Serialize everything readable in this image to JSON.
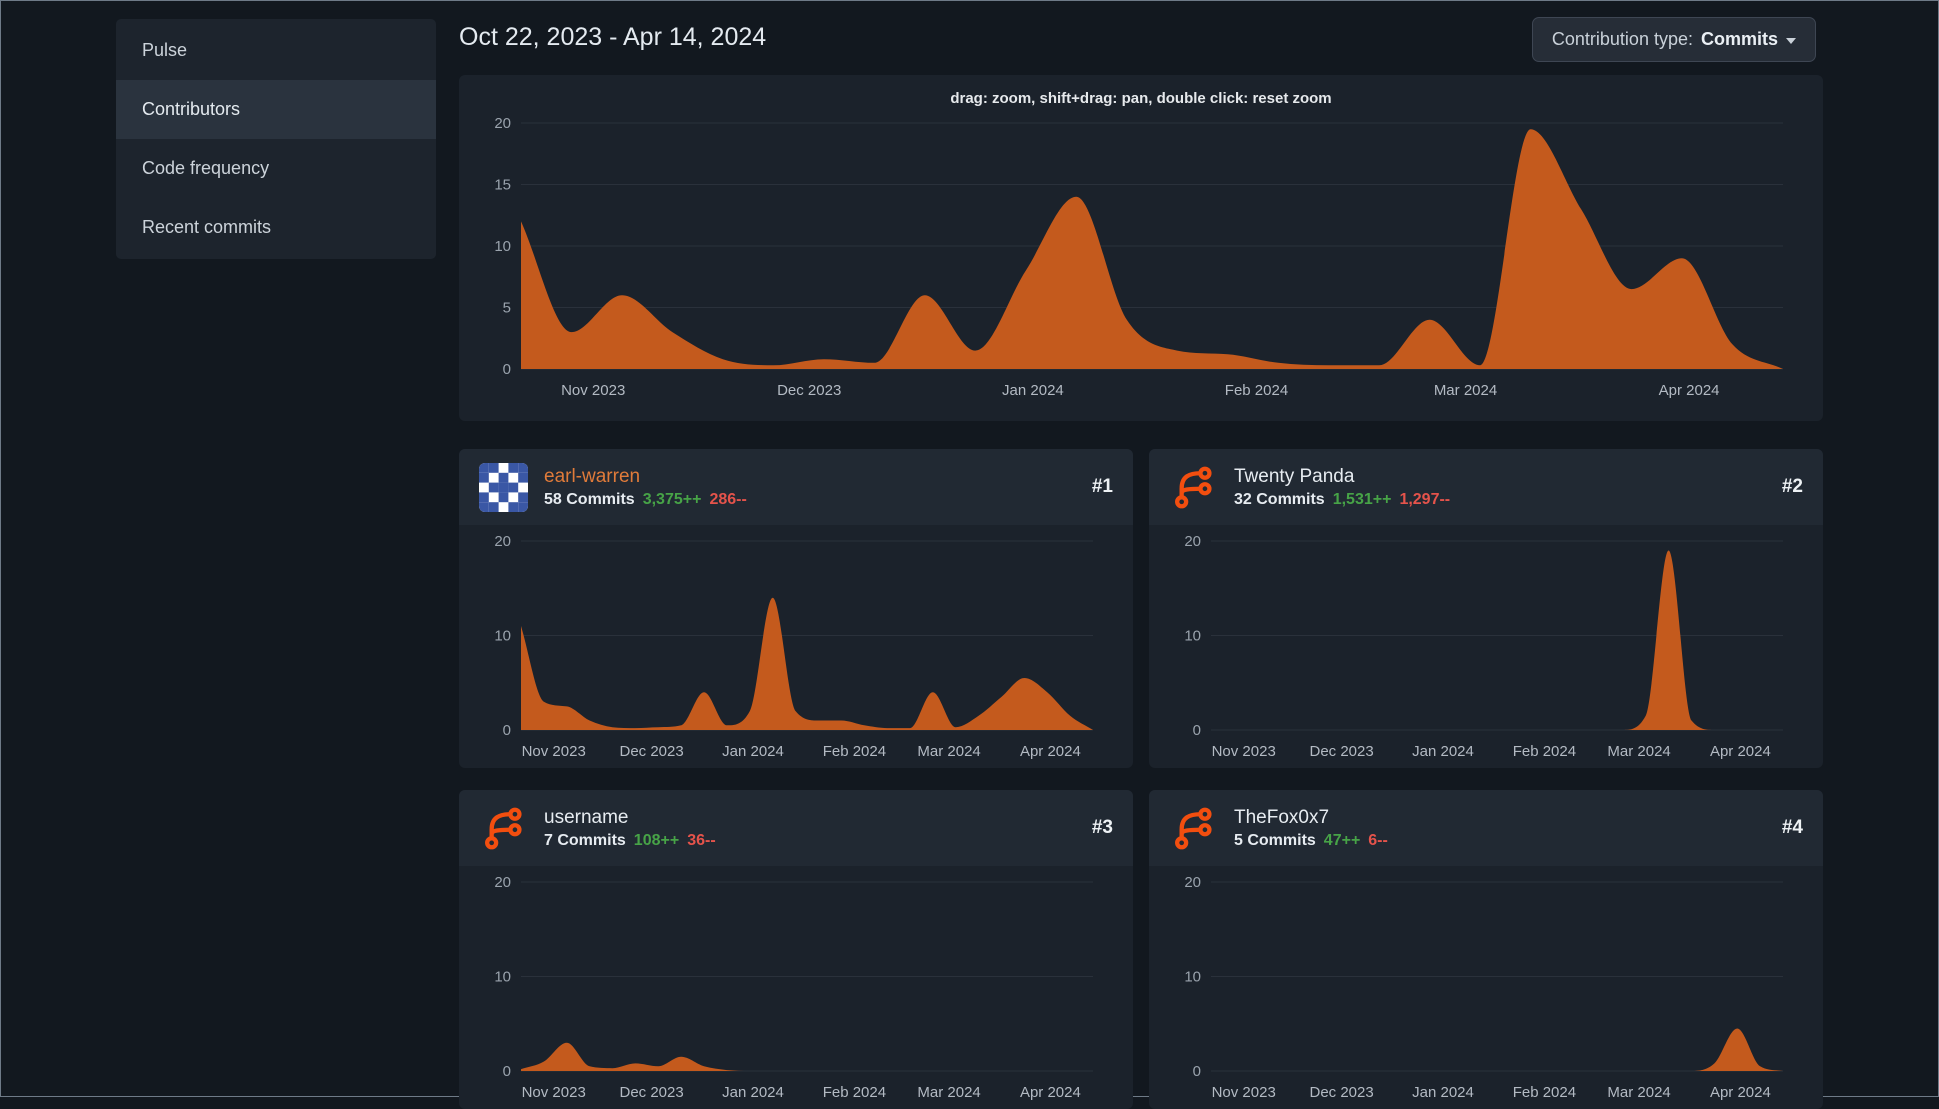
{
  "colors": {
    "page_bg": "#12181f",
    "panel_bg": "#1b222b",
    "chart_fill": "#c45a1d",
    "grid_line": "#2a313b",
    "axis_label": "#9aa3ad",
    "tick_label": "#b3bac3",
    "green": "#47a347",
    "red": "#e5534b",
    "link_orange": "#e07b3a",
    "logo_orange": "#f24e0f",
    "identicon_blue": "#3a57a5"
  },
  "sidebar": {
    "items": [
      {
        "label": "Pulse",
        "active": false
      },
      {
        "label": "Contributors",
        "active": true
      },
      {
        "label": "Code frequency",
        "active": false
      },
      {
        "label": "Recent commits",
        "active": false
      }
    ]
  },
  "header": {
    "date_range": "Oct 22, 2023 - Apr 14, 2024"
  },
  "contribution_type": {
    "label": "Contribution type:",
    "value": "Commits"
  },
  "main_chart_hint": "drag: zoom, shift+drag: pan, double click: reset zoom",
  "contributors": [
    {
      "name": "earl-warren",
      "rank": "#1",
      "commits_label": "58 Commits",
      "additions": "3,375++",
      "deletions": "286--",
      "avatar": "identicon"
    },
    {
      "name": "Twenty Panda",
      "rank": "#2",
      "commits_label": "32 Commits",
      "additions": "1,531++",
      "deletions": "1,297--",
      "avatar": "forgejo-logo"
    },
    {
      "name": "username",
      "rank": "#3",
      "commits_label": "7 Commits",
      "additions": "108++",
      "deletions": "36--",
      "avatar": "forgejo-logo"
    },
    {
      "name": "TheFox0x7",
      "rank": "#4",
      "commits_label": "5 Commits",
      "additions": "47++",
      "deletions": "6--",
      "avatar": "forgejo-logo"
    }
  ],
  "identicon_pattern": [
    [
      1,
      1,
      0,
      1,
      1
    ],
    [
      1,
      0,
      1,
      0,
      1
    ],
    [
      0,
      1,
      1,
      1,
      0
    ],
    [
      1,
      0,
      1,
      0,
      1
    ],
    [
      1,
      1,
      0,
      1,
      1
    ]
  ],
  "chart_data": [
    {
      "id": "overall-commits",
      "type": "area",
      "title": "",
      "xlabel": "",
      "ylabel": "",
      "ylim": [
        0,
        20
      ],
      "yticks": [
        0,
        5,
        10,
        15,
        20
      ],
      "grid": true,
      "legend": "none",
      "x_unit": "week (Oct 22, 2023 - Apr 14, 2024)",
      "x_weeks": 25,
      "xticks": [
        {
          "label": "Nov 2023",
          "week": 1.43
        },
        {
          "label": "Dec 2023",
          "week": 5.71
        },
        {
          "label": "Jan 2024",
          "week": 10.14
        },
        {
          "label": "Feb 2024",
          "week": 14.57
        },
        {
          "label": "Mar 2024",
          "week": 18.71
        },
        {
          "label": "Apr 2024",
          "week": 23.14
        }
      ],
      "values": [
        12,
        3,
        6,
        3,
        0.8,
        0.3,
        0.8,
        0.5,
        6,
        1.5,
        8,
        14,
        4,
        1.5,
        1.2,
        0.5,
        0.3,
        0.3,
        4,
        0.3,
        19.5,
        13,
        6.5,
        9,
        2,
        0
      ]
    },
    {
      "id": "earl-warren-commits",
      "type": "area",
      "ylim": [
        0,
        20
      ],
      "yticks": [
        0,
        10,
        20
      ],
      "grid": true,
      "x_weeks": 25,
      "xticks": [
        {
          "label": "Nov 2023",
          "week": 1.43
        },
        {
          "label": "Dec 2023",
          "week": 5.71
        },
        {
          "label": "Jan 2024",
          "week": 10.14
        },
        {
          "label": "Feb 2024",
          "week": 14.57
        },
        {
          "label": "Mar 2024",
          "week": 18.71
        },
        {
          "label": "Apr 2024",
          "week": 23.14
        }
      ],
      "values": [
        11,
        3,
        2.5,
        1,
        0.3,
        0.2,
        0.3,
        0.5,
        4,
        0.5,
        2,
        14,
        2,
        1,
        1,
        0.5,
        0.2,
        0.2,
        4,
        0.3,
        1.5,
        3.5,
        5.5,
        4,
        1.5,
        0
      ]
    },
    {
      "id": "twenty-panda-commits",
      "type": "area",
      "ylim": [
        0,
        20
      ],
      "yticks": [
        0,
        10,
        20
      ],
      "grid": true,
      "x_weeks": 25,
      "xticks": [
        {
          "label": "Nov 2023",
          "week": 1.43
        },
        {
          "label": "Dec 2023",
          "week": 5.71
        },
        {
          "label": "Jan 2024",
          "week": 10.14
        },
        {
          "label": "Feb 2024",
          "week": 14.57
        },
        {
          "label": "Mar 2024",
          "week": 18.71
        },
        {
          "label": "Apr 2024",
          "week": 23.14
        }
      ],
      "values": [
        0,
        0,
        0,
        0,
        0,
        0,
        0,
        0,
        0,
        0,
        0,
        0,
        0,
        0,
        0,
        0,
        0,
        0,
        0,
        1.5,
        19,
        1,
        0,
        0,
        0,
        0
      ]
    },
    {
      "id": "username-commits",
      "type": "area",
      "ylim": [
        0,
        20
      ],
      "yticks": [
        0,
        10,
        20
      ],
      "grid": true,
      "x_weeks": 25,
      "xticks": [
        {
          "label": "Nov 2023",
          "week": 1.43
        },
        {
          "label": "Dec 2023",
          "week": 5.71
        },
        {
          "label": "Jan 2024",
          "week": 10.14
        },
        {
          "label": "Feb 2024",
          "week": 14.57
        },
        {
          "label": "Mar 2024",
          "week": 18.71
        },
        {
          "label": "Apr 2024",
          "week": 23.14
        }
      ],
      "values": [
        0.2,
        1,
        3,
        0.5,
        0.3,
        0.8,
        0.5,
        1.5,
        0.5,
        0.1,
        0,
        0,
        0,
        0,
        0,
        0,
        0,
        0,
        0,
        0,
        0,
        0,
        0,
        0,
        0,
        0
      ]
    },
    {
      "id": "thefox0x7-commits",
      "type": "area",
      "ylim": [
        0,
        20
      ],
      "yticks": [
        0,
        10,
        20
      ],
      "grid": true,
      "x_weeks": 25,
      "xticks": [
        {
          "label": "Nov 2023",
          "week": 1.43
        },
        {
          "label": "Dec 2023",
          "week": 5.71
        },
        {
          "label": "Jan 2024",
          "week": 10.14
        },
        {
          "label": "Feb 2024",
          "week": 14.57
        },
        {
          "label": "Mar 2024",
          "week": 18.71
        },
        {
          "label": "Apr 2024",
          "week": 23.14
        }
      ],
      "values": [
        0,
        0,
        0,
        0,
        0,
        0,
        0,
        0,
        0,
        0,
        0,
        0,
        0,
        0,
        0,
        0,
        0,
        0,
        0,
        0,
        0,
        0,
        0.8,
        4.5,
        0.5,
        0
      ]
    }
  ]
}
